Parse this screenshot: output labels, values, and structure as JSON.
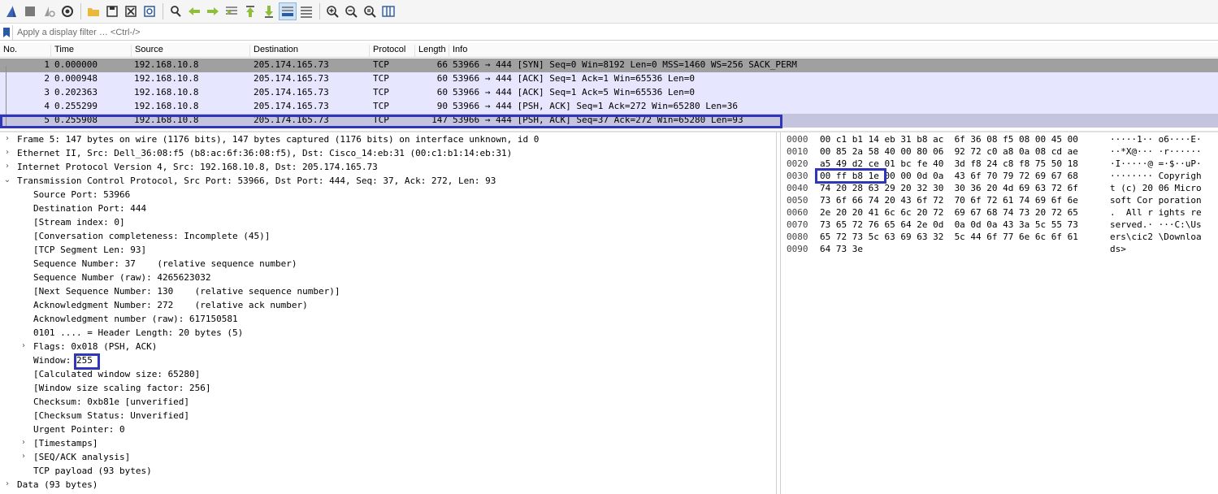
{
  "toolbar": {
    "icons": [
      "shark-fin-start-icon",
      "stop-icon",
      "restart-icon",
      "options-gear-icon",
      "open-folder-icon",
      "save-icon",
      "close-file-icon",
      "reload-icon",
      "find-icon",
      "go-back-icon",
      "go-forward-icon",
      "go-to-packet-icon",
      "first-packet-icon",
      "last-packet-icon",
      "autoscroll-icon",
      "colorize-icon",
      "zoom-in-icon",
      "zoom-out-icon",
      "zoom-normal-icon",
      "resize-columns-icon"
    ]
  },
  "filter": {
    "placeholder": "Apply a display filter … <Ctrl-/>"
  },
  "packet_list": {
    "columns": [
      "No.",
      "Time",
      "Source",
      "Destination",
      "Protocol",
      "Length",
      "Info"
    ],
    "rows": [
      {
        "no": "1",
        "time": "0.000000",
        "src": "192.168.10.8",
        "dst": "205.174.165.73",
        "proto": "TCP",
        "len": "66",
        "info": "53966 → 444 [SYN] Seq=0 Win=8192 Len=0 MSS=1460 WS=256 SACK_PERM"
      },
      {
        "no": "2",
        "time": "0.000948",
        "src": "192.168.10.8",
        "dst": "205.174.165.73",
        "proto": "TCP",
        "len": "60",
        "info": "53966 → 444 [ACK] Seq=1 Ack=1 Win=65536 Len=0"
      },
      {
        "no": "3",
        "time": "0.202363",
        "src": "192.168.10.8",
        "dst": "205.174.165.73",
        "proto": "TCP",
        "len": "60",
        "info": "53966 → 444 [ACK] Seq=1 Ack=5 Win=65536 Len=0"
      },
      {
        "no": "4",
        "time": "0.255299",
        "src": "192.168.10.8",
        "dst": "205.174.165.73",
        "proto": "TCP",
        "len": "90",
        "info": "53966 → 444 [PSH, ACK] Seq=1 Ack=272 Win=65280 Len=36"
      },
      {
        "no": "5",
        "time": "0.255908",
        "src": "192.168.10.8",
        "dst": "205.174.165.73",
        "proto": "TCP",
        "len": "147",
        "info": "53966 → 444 [PSH, ACK] Seq=37 Ack=272 Win=65280 Len=93"
      }
    ]
  },
  "details": {
    "rows": [
      {
        "level": 0,
        "arrow": "›",
        "text": "Frame 5: 147 bytes on wire (1176 bits), 147 bytes captured (1176 bits) on interface unknown, id 0"
      },
      {
        "level": 0,
        "arrow": "›",
        "text": "Ethernet II, Src: Dell_36:08:f5 (b8:ac:6f:36:08:f5), Dst: Cisco_14:eb:31 (00:c1:b1:14:eb:31)"
      },
      {
        "level": 0,
        "arrow": "›",
        "text": "Internet Protocol Version 4, Src: 192.168.10.8, Dst: 205.174.165.73"
      },
      {
        "level": 0,
        "arrow": "⌄",
        "text": "Transmission Control Protocol, Src Port: 53966, Dst Port: 444, Seq: 37, Ack: 272, Len: 93"
      },
      {
        "level": 1,
        "arrow": "",
        "text": "Source Port: 53966"
      },
      {
        "level": 1,
        "arrow": "",
        "text": "Destination Port: 444"
      },
      {
        "level": 1,
        "arrow": "",
        "text": "[Stream index: 0]"
      },
      {
        "level": 1,
        "arrow": "",
        "text": "[Conversation completeness: Incomplete (45)]"
      },
      {
        "level": 1,
        "arrow": "",
        "text": "[TCP Segment Len: 93]"
      },
      {
        "level": 1,
        "arrow": "",
        "text": "Sequence Number: 37    (relative sequence number)"
      },
      {
        "level": 1,
        "arrow": "",
        "text": "Sequence Number (raw): 4265623032"
      },
      {
        "level": 1,
        "arrow": "",
        "text": "[Next Sequence Number: 130    (relative sequence number)]"
      },
      {
        "level": 1,
        "arrow": "",
        "text": "Acknowledgment Number: 272    (relative ack number)"
      },
      {
        "level": 1,
        "arrow": "",
        "text": "Acknowledgment number (raw): 617150581"
      },
      {
        "level": 1,
        "arrow": "",
        "text": "0101 .... = Header Length: 20 bytes (5)"
      },
      {
        "level": 1,
        "arrow": "›",
        "text": "Flags: 0x018 (PSH, ACK)"
      },
      {
        "level": 1,
        "arrow": "",
        "text": "Window: 255"
      },
      {
        "level": 1,
        "arrow": "",
        "text": "[Calculated window size: 65280]"
      },
      {
        "level": 1,
        "arrow": "",
        "text": "[Window size scaling factor: 256]"
      },
      {
        "level": 1,
        "arrow": "",
        "text": "Checksum: 0xb81e [unverified]"
      },
      {
        "level": 1,
        "arrow": "",
        "text": "[Checksum Status: Unverified]"
      },
      {
        "level": 1,
        "arrow": "",
        "text": "Urgent Pointer: 0"
      },
      {
        "level": 1,
        "arrow": "›",
        "text": "[Timestamps]"
      },
      {
        "level": 1,
        "arrow": "›",
        "text": "[SEQ/ACK analysis]"
      },
      {
        "level": 1,
        "arrow": "",
        "text": "TCP payload (93 bytes)"
      },
      {
        "level": 0,
        "arrow": "›",
        "text": "Data (93 bytes)"
      }
    ]
  },
  "bytes": {
    "rows": [
      {
        "off": "0000",
        "hex": "00 c1 b1 14 eb 31 b8 ac  6f 36 08 f5 08 00 45 00",
        "ascii": "·····1·· o6····E·"
      },
      {
        "off": "0010",
        "hex": "00 85 2a 58 40 00 80 06  92 72 c0 a8 0a 08 cd ae",
        "ascii": "··*X@··· ·r······"
      },
      {
        "off": "0020",
        "hex": "a5 49 d2 ce 01 bc fe 40  3d f8 24 c8 f8 75 50 18",
        "ascii": "·I·····@ =·$··uP·"
      },
      {
        "off": "0030",
        "hex": "00 ff b8 1e 00 00 0d 0a  43 6f 70 79 72 69 67 68",
        "ascii": "········ Copyrigh"
      },
      {
        "off": "0040",
        "hex": "74 20 28 63 29 20 32 30  30 36 20 4d 69 63 72 6f",
        "ascii": "t (c) 20 06 Micro"
      },
      {
        "off": "0050",
        "hex": "73 6f 66 74 20 43 6f 72  70 6f 72 61 74 69 6f 6e",
        "ascii": "soft Cor poration"
      },
      {
        "off": "0060",
        "hex": "2e 20 20 41 6c 6c 20 72  69 67 68 74 73 20 72 65",
        "ascii": ".  All r ights re"
      },
      {
        "off": "0070",
        "hex": "73 65 72 76 65 64 2e 0d  0a 0d 0a 43 3a 5c 55 73",
        "ascii": "served.· ···C:\\Us"
      },
      {
        "off": "0080",
        "hex": "65 72 73 5c 63 69 63 32  5c 44 6f 77 6e 6c 6f 61",
        "ascii": "ers\\cic2 \\Downloa"
      },
      {
        "off": "0090",
        "hex": "64 73 3e",
        "ascii": "ds>"
      }
    ]
  },
  "colors": {
    "syn_row": "#a0a0a0",
    "tcp_row": "#e7e6ff",
    "selected_row": "#c5c4de",
    "annotation_box": "#2f36b8"
  }
}
